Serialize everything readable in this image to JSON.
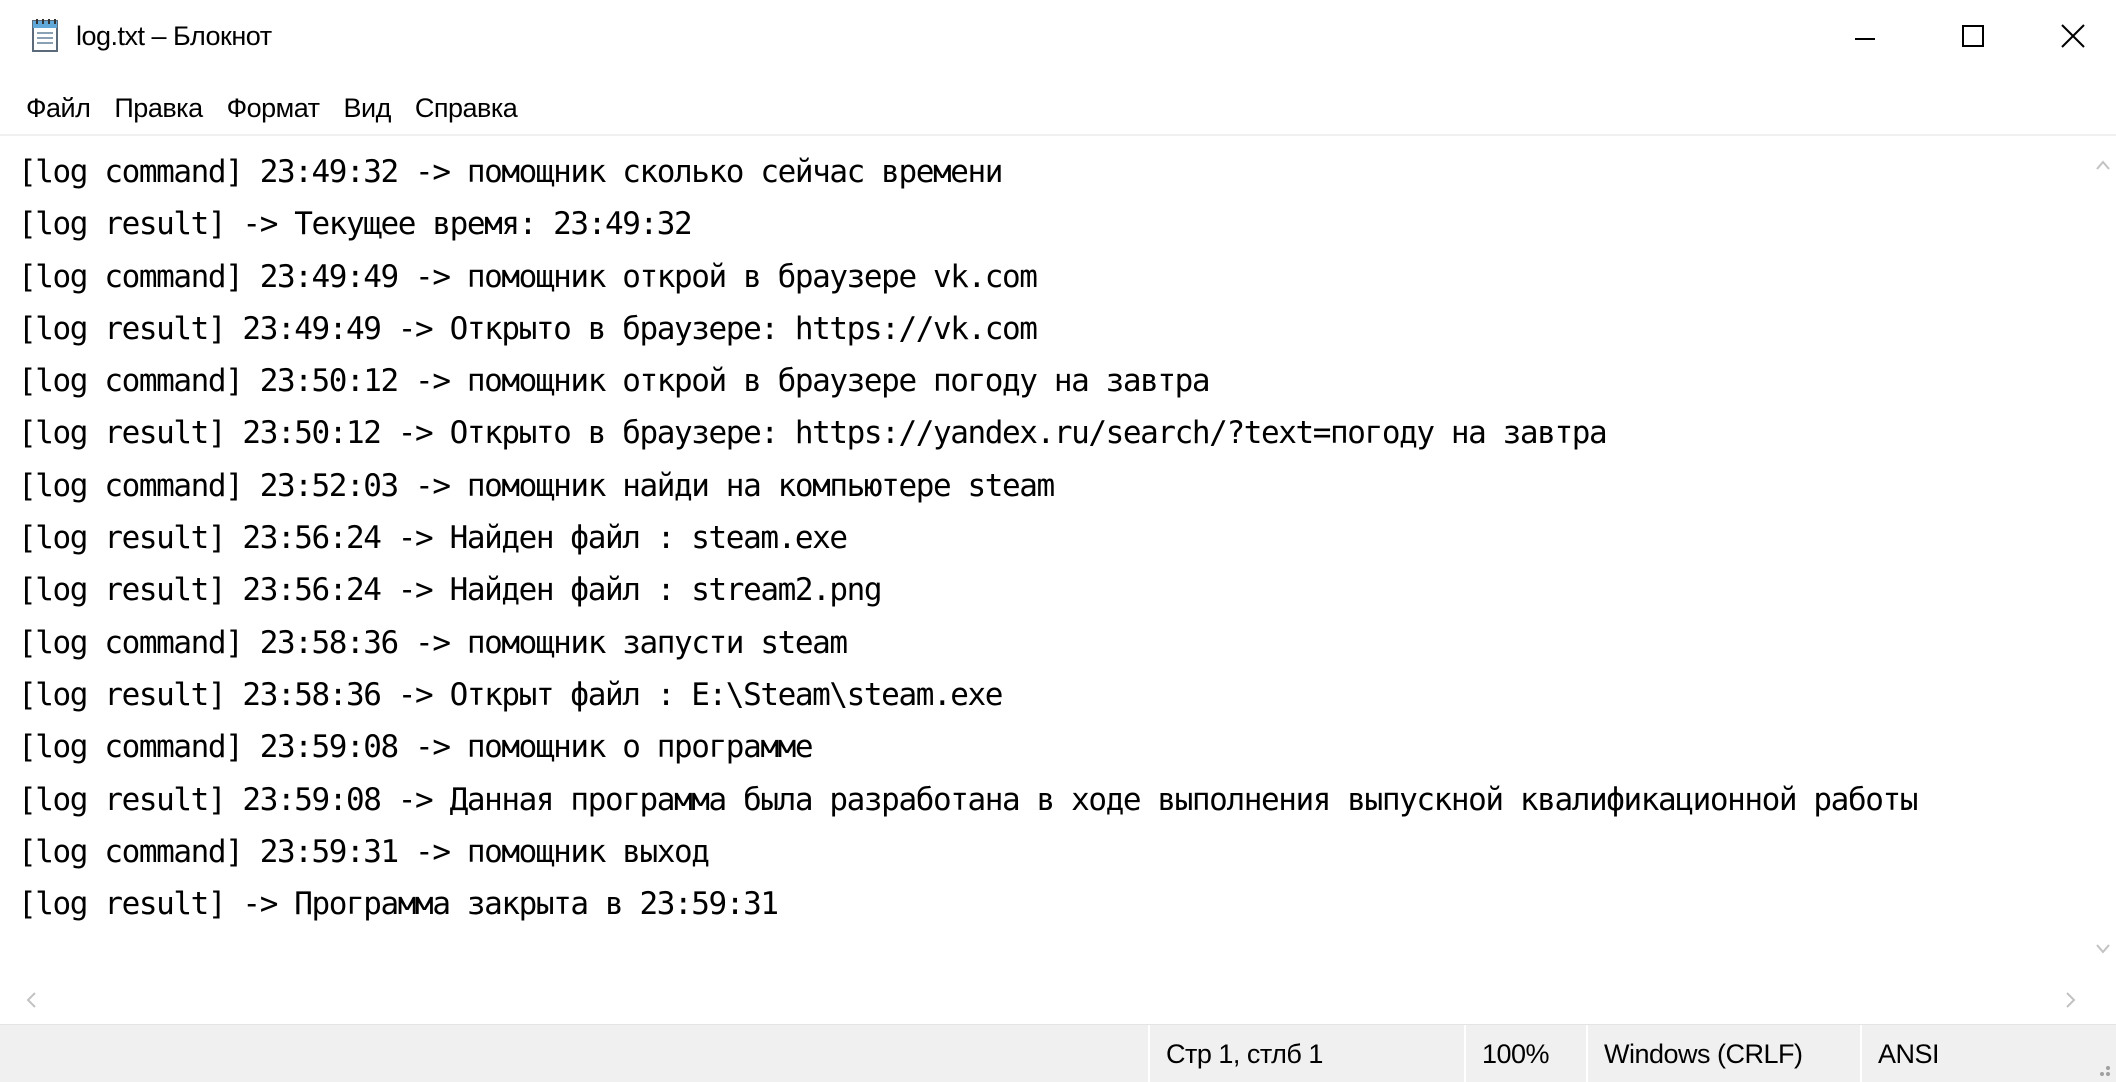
{
  "window": {
    "title": "log.txt – Блокнот",
    "icon": "notepad-icon"
  },
  "menu": [
    {
      "label": "Файл"
    },
    {
      "label": "Правка"
    },
    {
      "label": "Формат"
    },
    {
      "label": "Вид"
    },
    {
      "label": "Справка"
    }
  ],
  "editor": {
    "lines": [
      "[log command] 23:49:32 -> помощник сколько сейчас времени",
      "[log result] -> Текущее время: 23:49:32",
      "[log command] 23:49:49 -> помощник открой в браузере vk.com",
      "[log result] 23:49:49 -> Открыто в браузере: https://vk.com",
      "[log command] 23:50:12 -> помощник открой в браузере погоду на завтра",
      "[log result] 23:50:12 -> Открыто в браузере: https://yandex.ru/search/?text=погоду на завтра",
      "[log command] 23:52:03 -> помощник найди на компьютере steam",
      "[log result] 23:56:24 -> Найден файл : steam.exe",
      "[log result] 23:56:24 -> Найден файл : stream2.png",
      "[log command] 23:58:36 -> помощник запусти steam",
      "[log result] 23:58:36 -> Открыт файл : E:\\Steam\\steam.exe",
      "[log command] 23:59:08 -> помощник о программе",
      "[log result] 23:59:08 -> Данная программа была разработана в ходе выполнения выпускной квалификационной работы",
      "[log command] 23:59:31 -> помощник выход",
      "[log result] -> Программа закрыта в 23:59:31"
    ]
  },
  "status": {
    "position": "Стр 1, стлб 1",
    "zoom": "100%",
    "line_ending": "Windows (CRLF)",
    "encoding": "ANSI"
  }
}
